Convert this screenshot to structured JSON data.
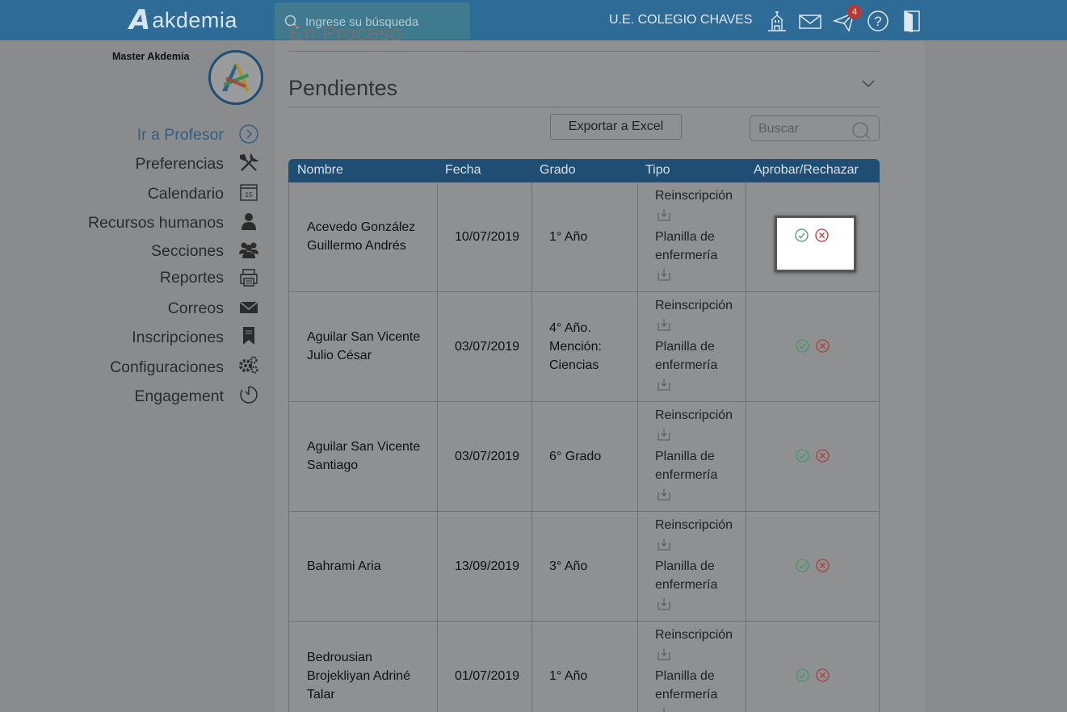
{
  "topbar": {
    "logo_text": "akdemia",
    "search_placeholder": "Ingrese su búsqueda",
    "school_name": "U.E. COLEGIO CHAVES",
    "notification_count": "4",
    "icons": [
      "search-icon",
      "school-icon",
      "mail-icon",
      "send-icon",
      "help-icon",
      "logout-icon"
    ]
  },
  "sidebar": {
    "user_name": "Master Akdemia",
    "items": [
      {
        "label": "Ir a Profesor",
        "icon": "arrow-circle-icon"
      },
      {
        "label": "Preferencias",
        "icon": "tools-icon"
      },
      {
        "label": "Calendario",
        "icon": "calendar-icon"
      },
      {
        "label": "Recursos humanos",
        "icon": "person-icon"
      },
      {
        "label": "Secciones",
        "icon": "group-icon"
      },
      {
        "label": "Reportes",
        "icon": "printer-icon"
      },
      {
        "label": "Correos",
        "icon": "envelope-icon"
      },
      {
        "label": "Inscripciones",
        "icon": "bookmark-icon"
      },
      {
        "label": "Configuraciones",
        "icon": "gears-icon"
      },
      {
        "label": "Engagement",
        "icon": "timer-icon"
      }
    ],
    "calendar_day": "15"
  },
  "main": {
    "en_proceso_title": "En Proceso",
    "pendientes_title": "Pendientes",
    "export_label": "Exportar a Excel",
    "buscar_placeholder": "Buscar",
    "table": {
      "headers": [
        "Nombre",
        "Fecha",
        "Grado",
        "Tipo",
        "Aprobar/Rechazar"
      ],
      "rows": [
        {
          "name": [
            "Acevedo González",
            "Guillermo Andrés"
          ],
          "date": "10/07/2019",
          "grade": [
            "1° Año"
          ],
          "tipo1": "Reinscripción",
          "tipo2": [
            "Planilla de",
            "enfermería"
          ]
        },
        {
          "name": [
            "Aguilar San Vicente",
            "Julio César"
          ],
          "date": "03/07/2019",
          "grade": [
            "4° Año.",
            "Mención:",
            "Ciencias"
          ],
          "tipo1": "Reinscripción",
          "tipo2": [
            "Planilla de",
            "enfermería"
          ]
        },
        {
          "name": [
            "Aguilar San Vicente",
            "Santiago"
          ],
          "date": "03/07/2019",
          "grade": [
            "6° Grado"
          ],
          "tipo1": "Reinscripción",
          "tipo2": [
            "Planilla de",
            "enfermería"
          ]
        },
        {
          "name": [
            "Bahrami Aria"
          ],
          "date": "13/09/2019",
          "grade": [
            "3° Año"
          ],
          "tipo1": "Reinscripción",
          "tipo2": [
            "Planilla de",
            "enfermería"
          ]
        },
        {
          "name": [
            "Bedrousian",
            "Brojekliyan Adriné",
            "Talar"
          ],
          "date": "01/07/2019",
          "grade": [
            "1° Año"
          ],
          "tipo1": "Reinscripción",
          "tipo2": [
            "Planilla de",
            "enfermería"
          ]
        }
      ]
    }
  },
  "colors": {
    "topbar": "#2e6b96",
    "table_header": "#1f4d73",
    "approve": "#3d9a6a",
    "reject": "#b43a3a"
  }
}
